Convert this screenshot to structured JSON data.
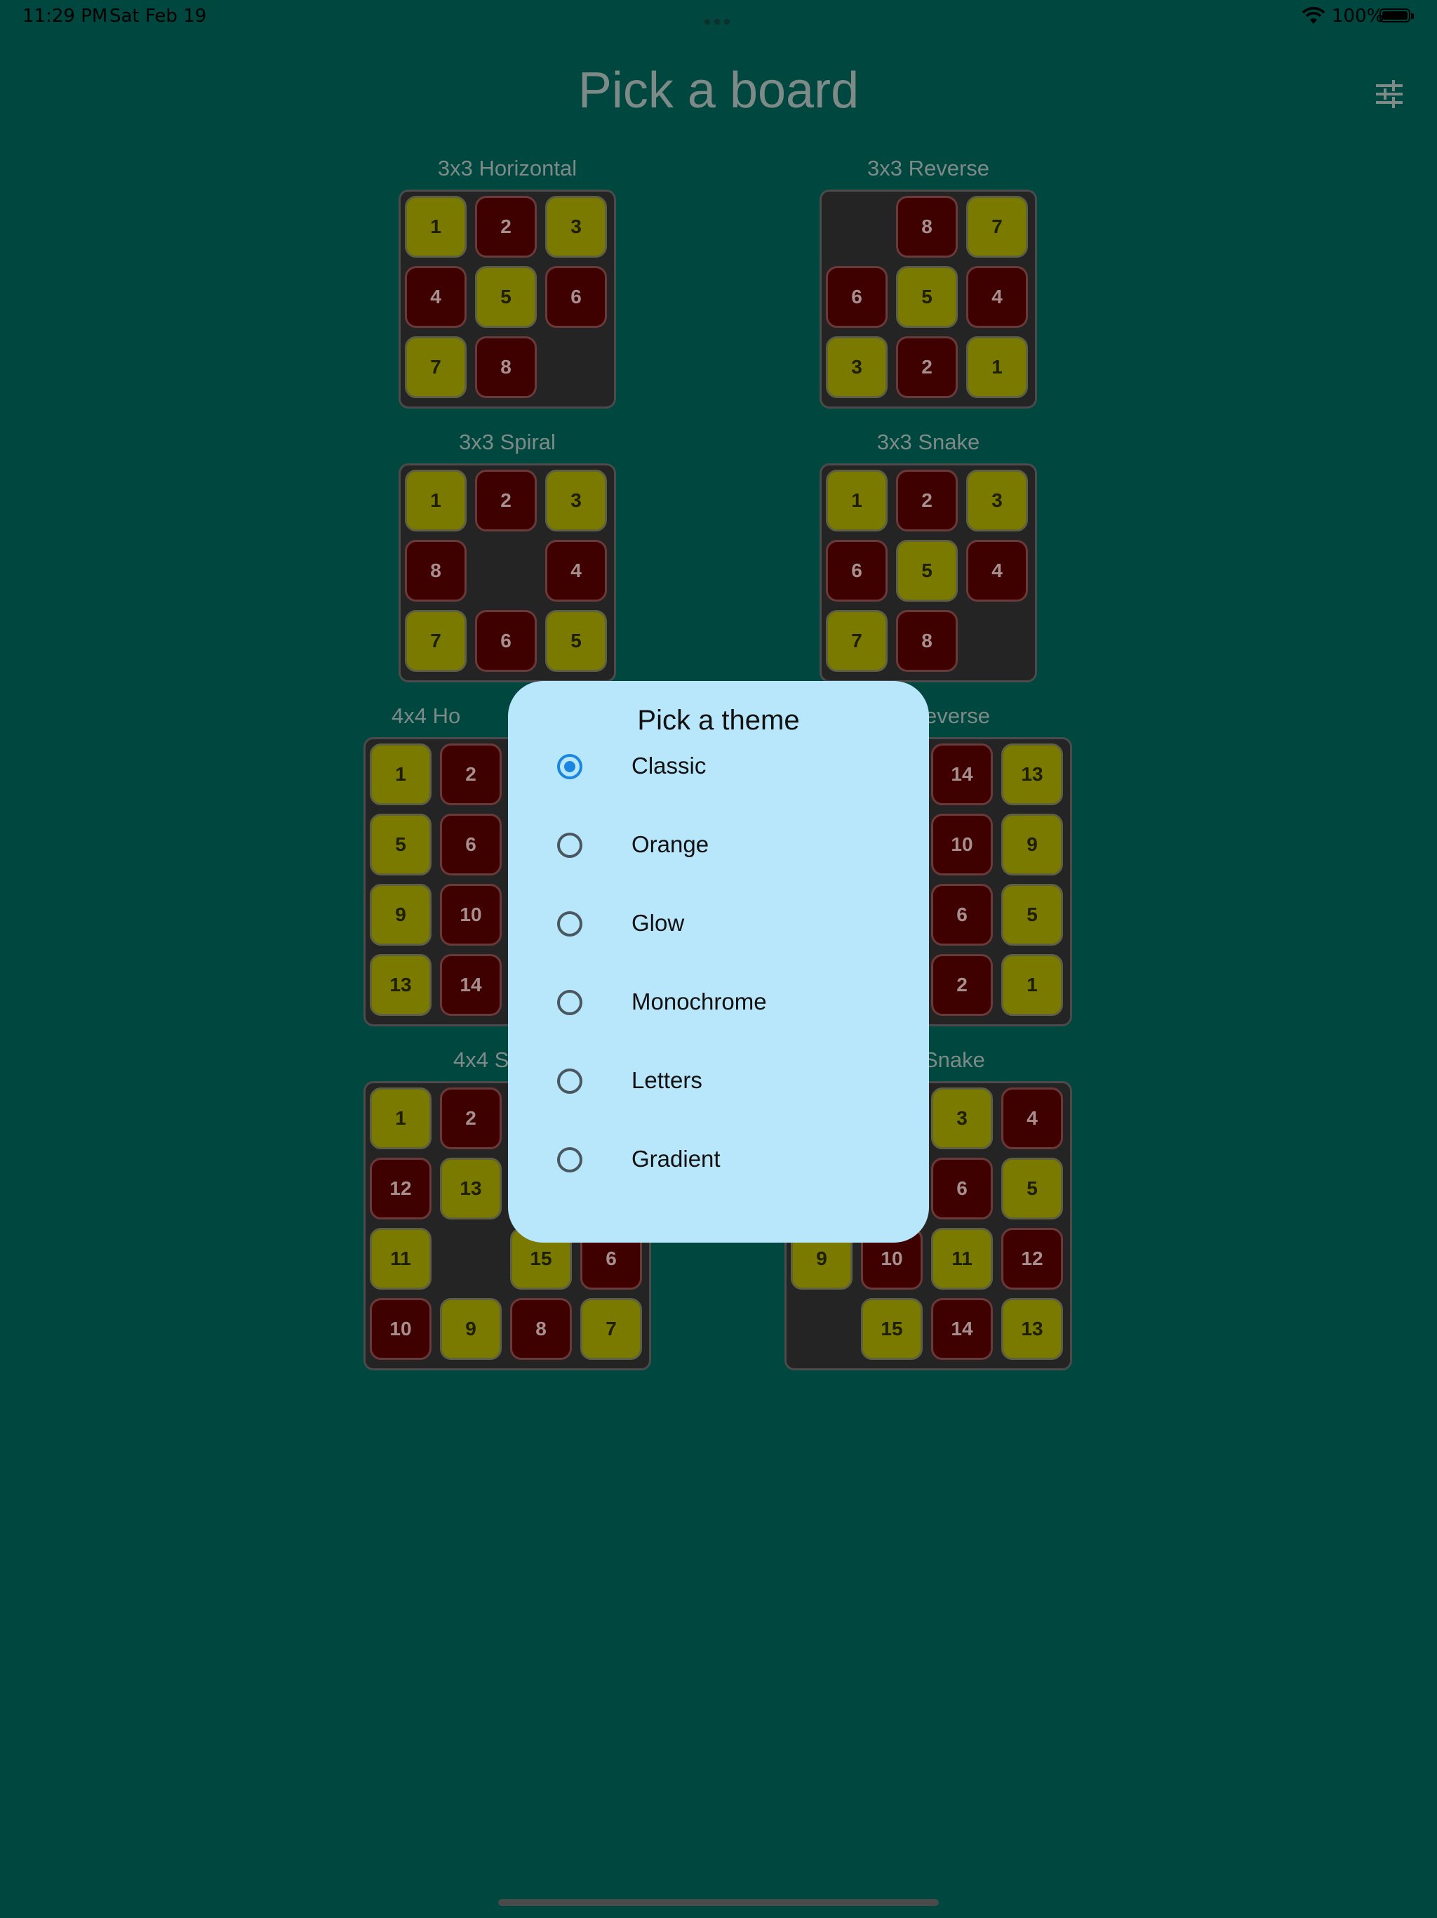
{
  "status_bar": {
    "time": "11:29 PM",
    "date": "Sat Feb 19",
    "battery": "100%"
  },
  "page_title": "Pick a board",
  "boards": [
    {
      "label": "3x3 Horizontal",
      "tiles": [
        "1",
        "2",
        "3",
        "4",
        "5",
        "6",
        "7",
        "8",
        ""
      ]
    },
    {
      "label": "3x3 Reverse",
      "tiles": [
        "",
        "8",
        "7",
        "6",
        "5",
        "4",
        "3",
        "2",
        "1"
      ]
    },
    {
      "label": "3x3 Spiral",
      "tiles": [
        "1",
        "2",
        "3",
        "8",
        "",
        "4",
        "7",
        "6",
        "5"
      ]
    },
    {
      "label": "3x3 Snake",
      "tiles": [
        "1",
        "2",
        "3",
        "6",
        "5",
        "4",
        "7",
        "8",
        ""
      ]
    },
    {
      "label": "4x4 Ho",
      "tiles": [
        "1",
        "2",
        "",
        "",
        "5",
        "6",
        "",
        "",
        "9",
        "10",
        "",
        "",
        "13",
        "14",
        "",
        ""
      ]
    },
    {
      "label": "everse",
      "tiles": [
        "",
        "",
        "14",
        "13",
        "",
        "",
        "10",
        "9",
        "",
        "",
        "6",
        "5",
        "",
        "",
        "2",
        "1"
      ]
    },
    {
      "label": "4x4 S",
      "tiles": [
        "1",
        "2",
        "",
        "",
        "12",
        "13",
        "",
        "",
        "11",
        "",
        "15",
        "6",
        "10",
        "9",
        "8",
        "7"
      ]
    },
    {
      "label": "Snake",
      "tiles": [
        "",
        "",
        "3",
        "4",
        "",
        "",
        "6",
        "5",
        "9",
        "10",
        "11",
        "12",
        "",
        "15",
        "14",
        "13"
      ]
    }
  ],
  "dialog": {
    "title": "Pick a theme",
    "options": [
      {
        "label": "Classic",
        "selected": true
      },
      {
        "label": "Orange",
        "selected": false
      },
      {
        "label": "Glow",
        "selected": false
      },
      {
        "label": "Monochrome",
        "selected": false
      },
      {
        "label": "Letters",
        "selected": false
      },
      {
        "label": "Gradient",
        "selected": false
      }
    ]
  },
  "colors": {
    "background": "#00473f",
    "tile_odd": "#7a7a00",
    "tile_even": "#3f0000",
    "dialog": "#b8e6fa",
    "radio_selected": "#1b86e0"
  }
}
